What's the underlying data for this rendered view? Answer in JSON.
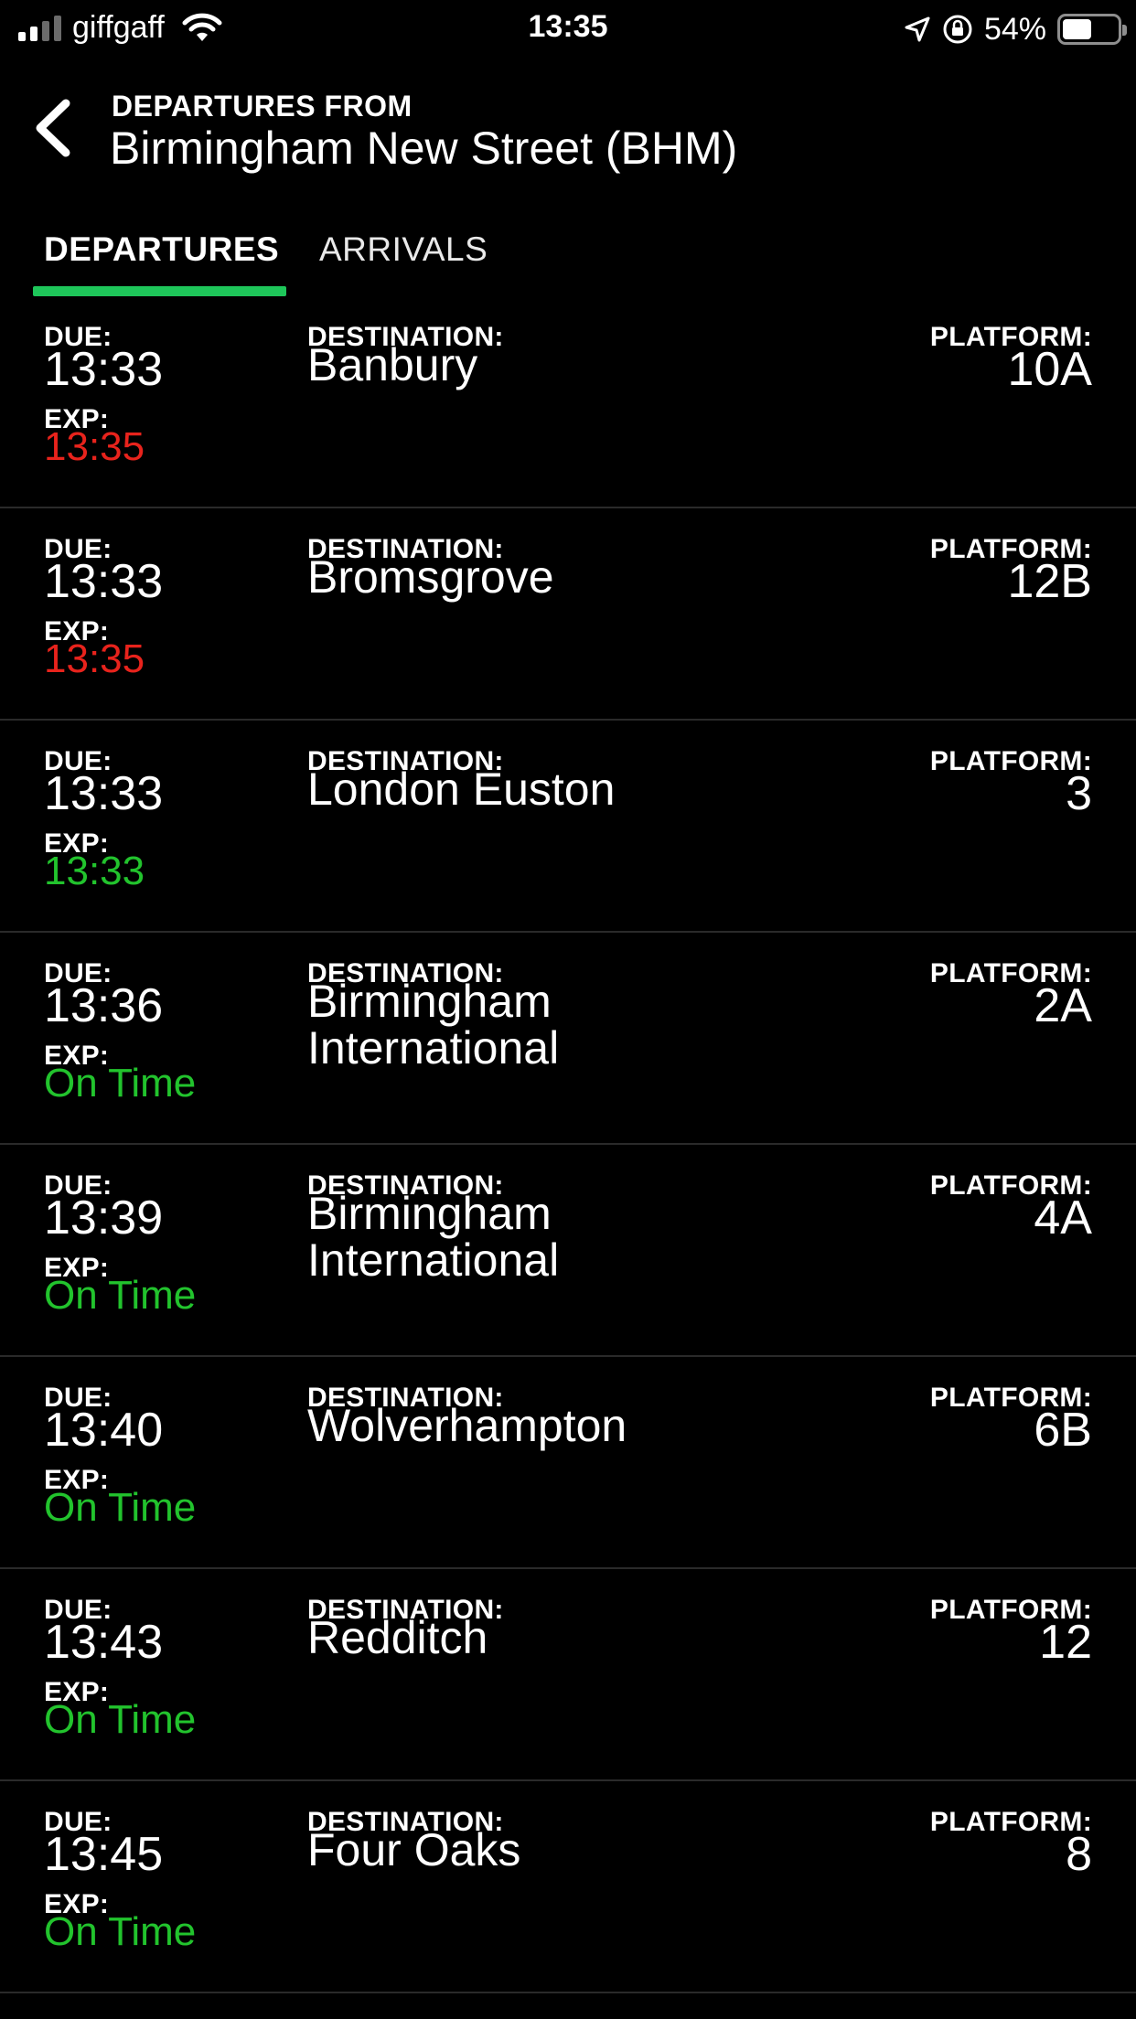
{
  "status_bar": {
    "carrier": "giffgaff",
    "time": "13:35",
    "battery_percent_label": "54%",
    "battery_level": 0.54
  },
  "header": {
    "subtitle": "DEPARTURES FROM",
    "title": "Birmingham New Street (BHM)"
  },
  "tabs": [
    {
      "label": "DEPARTURES",
      "active": true
    },
    {
      "label": "ARRIVALS",
      "active": false
    }
  ],
  "labels": {
    "due": "DUE:",
    "exp": "EXP:",
    "destination": "DESTINATION:",
    "platform": "PLATFORM:"
  },
  "colors": {
    "accent": "#1ec65a",
    "late": "#e8231c",
    "on_time": "#22c32d"
  },
  "departures": [
    {
      "due": "13:33",
      "expected": "13:35",
      "status": "late",
      "destination": "Banbury",
      "platform": "10A"
    },
    {
      "due": "13:33",
      "expected": "13:35",
      "status": "late",
      "destination": "Bromsgrove",
      "platform": "12B"
    },
    {
      "due": "13:33",
      "expected": "13:33",
      "status": "on_time",
      "destination": "London Euston",
      "platform": "3"
    },
    {
      "due": "13:36",
      "expected": "On Time",
      "status": "on_time",
      "destination": "Birmingham International",
      "platform": "2A"
    },
    {
      "due": "13:39",
      "expected": "On Time",
      "status": "on_time",
      "destination": "Birmingham International",
      "platform": "4A"
    },
    {
      "due": "13:40",
      "expected": "On Time",
      "status": "on_time",
      "destination": "Wolverhampton",
      "platform": "6B"
    },
    {
      "due": "13:43",
      "expected": "On Time",
      "status": "on_time",
      "destination": "Redditch",
      "platform": "12"
    },
    {
      "due": "13:45",
      "expected": "On Time",
      "status": "on_time",
      "destination": "Four Oaks",
      "platform": "8"
    }
  ]
}
